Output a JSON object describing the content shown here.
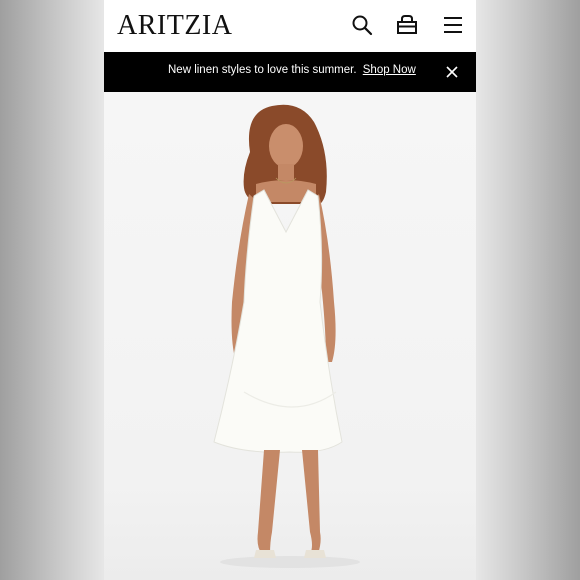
{
  "header": {
    "logo": "ARITZIA",
    "icons": [
      "search-icon",
      "bag-icon",
      "menu-icon"
    ]
  },
  "banner": {
    "message": "New linen styles to love this summer.",
    "link_label": "Shop Now",
    "close_icon": "close-icon"
  },
  "hero": {
    "image": "model-in-white-slip-dress"
  },
  "colors": {
    "banner_bg": "#000000",
    "banner_text": "#ffffff",
    "header_bg": "#ffffff"
  }
}
